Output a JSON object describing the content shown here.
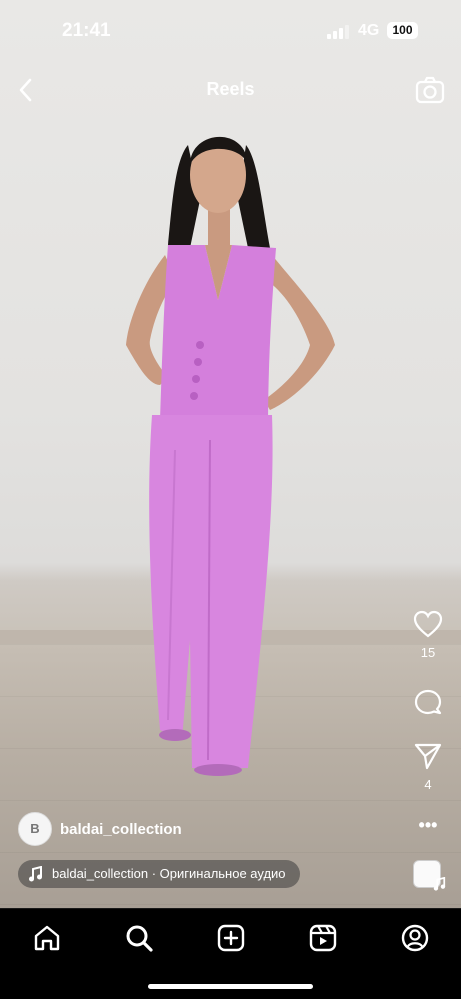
{
  "status_bar": {
    "time": "21:41",
    "network": "4G",
    "battery": "100"
  },
  "header": {
    "title": "Reels",
    "back_icon": "chevron-left-icon",
    "camera_icon": "camera-icon"
  },
  "actions": {
    "like_count": "15",
    "share_count": "4",
    "like_icon": "heart-icon",
    "comment_icon": "comment-icon",
    "share_icon": "send-icon"
  },
  "author": {
    "avatar_text": "B",
    "username": "baldai_collection"
  },
  "audio": {
    "label": "baldai_collection · Оригинальное аудио"
  },
  "bottom_nav": {
    "items": [
      "home-icon",
      "search-icon",
      "plus-square-icon",
      "reels-icon",
      "profile-icon"
    ]
  },
  "colors": {
    "outfit": "#d47fdc",
    "wall": "#e6e5e3",
    "floor": "#b6ada2"
  }
}
